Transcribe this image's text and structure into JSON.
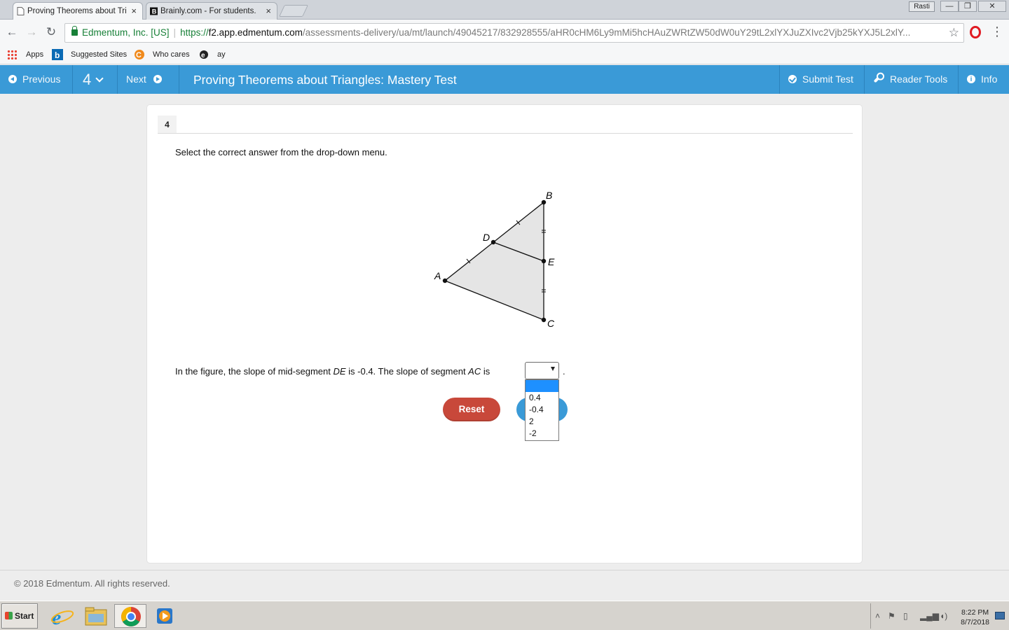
{
  "browser": {
    "tabs": [
      {
        "title": "Proving Theorems about Tri",
        "close": "×"
      },
      {
        "title": "Brainly.com - For students.",
        "close": "×"
      }
    ],
    "user_badge": "Rasti",
    "window_controls": {
      "minimize": "—",
      "restore": "❐",
      "close": "✕"
    },
    "url": {
      "site_id": "Edmentum, Inc. [US]",
      "scheme": "https://",
      "host": "f2.app.edmentum.com",
      "path": "/assessments-delivery/ua/mt/launch/49045217/832928555/aHR0cHM6Ly9mMi5hcHAuZWRtZW50dW0uY29tL2xlYXJuZXIvc2Vjb25kYXJ5L2xlY..."
    },
    "bookmarks": [
      "Apps",
      "Suggested Sites",
      "Who cares",
      "ay"
    ]
  },
  "header": {
    "previous_label": "Previous",
    "question_number": "4",
    "next_label": "Next",
    "title": "Proving Theorems about Triangles: Mastery Test",
    "submit_label": "Submit Test",
    "reader_tools_label": "Reader Tools",
    "info_label": "Info"
  },
  "question": {
    "number": "4",
    "instruction": "Select the correct answer from the drop-down menu.",
    "text_before": "In the figure, the slope of mid-segment ",
    "segment_1": "DE",
    "text_middle": " is -0.4. The slope of segment ",
    "segment_2": "AC",
    "text_after": " is",
    "period": ".",
    "figure_labels": {
      "A": "A",
      "B": "B",
      "C": "C",
      "D": "D",
      "E": "E"
    },
    "dropdown": {
      "selected": "",
      "options": [
        "",
        "0.4",
        "-0.4",
        "2",
        "-2"
      ]
    },
    "reset_label": "Reset"
  },
  "footer": {
    "copyright": "© 2018 Edmentum. All rights reserved."
  },
  "taskbar": {
    "start_label": "Start",
    "time": "8:22 PM",
    "date": "8/7/2018"
  },
  "colors": {
    "header_blue": "#3a9ad7",
    "reset_red": "#c8483a",
    "selected_option": "#1e90ff",
    "secure_green": "#188038"
  }
}
